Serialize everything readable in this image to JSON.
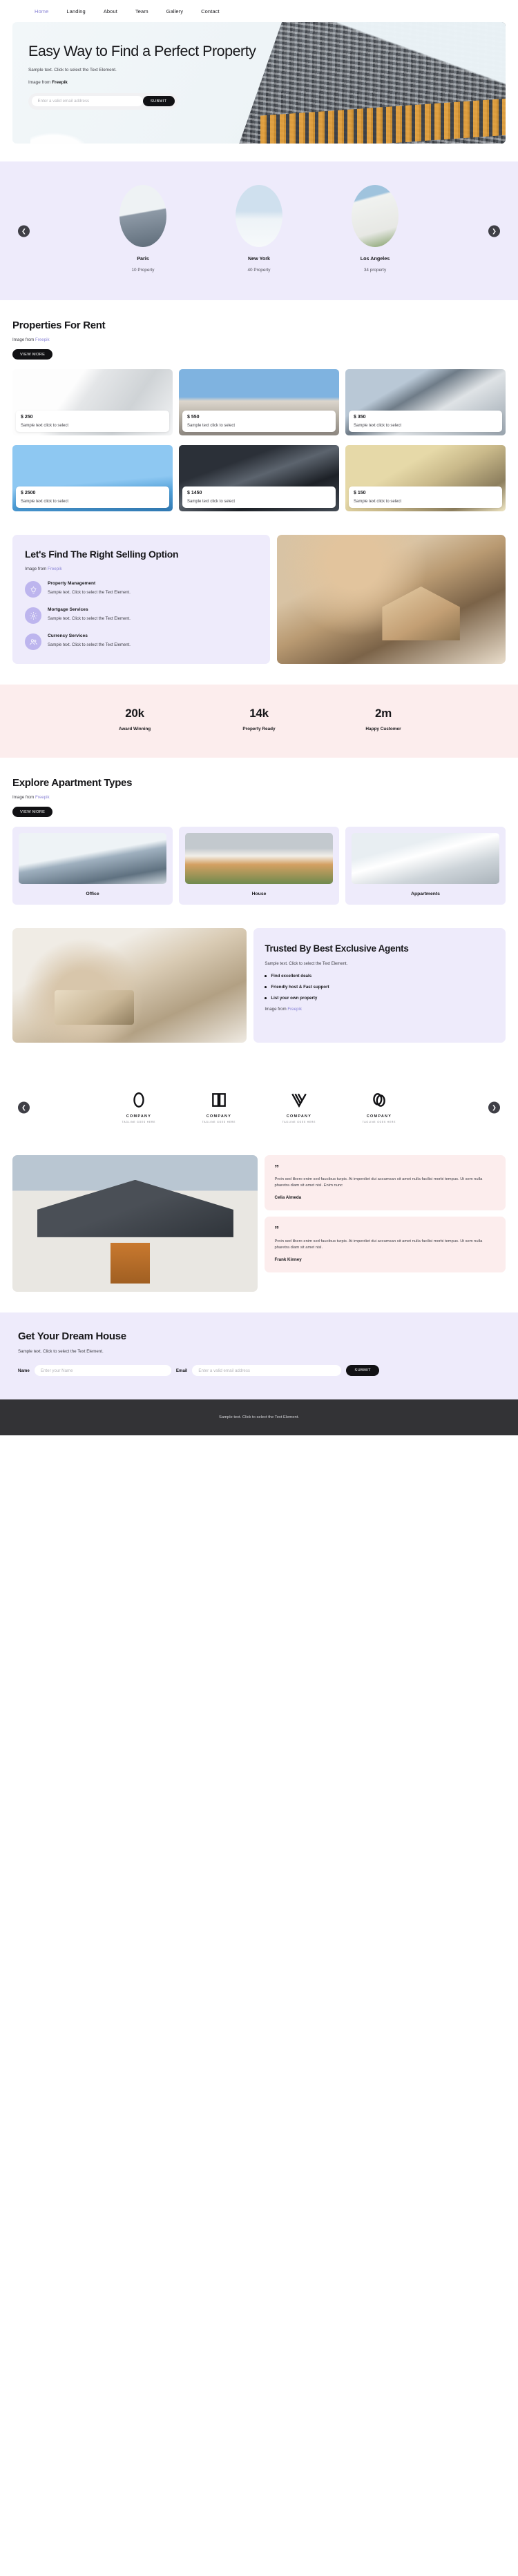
{
  "nav": {
    "items": [
      {
        "label": "Home",
        "active": true
      },
      {
        "label": "Landing",
        "active": false
      },
      {
        "label": "About",
        "active": false
      },
      {
        "label": "Team",
        "active": false
      },
      {
        "label": "Gallery",
        "active": false
      },
      {
        "label": "Contact",
        "active": false
      }
    ]
  },
  "hero": {
    "title": "Easy Way to Find a Perfect Property",
    "subtitle": "Sample text. Click to select the Text Element.",
    "credit_prefix": "Image from ",
    "credit_source": "Freepik",
    "email_placeholder": "Enter a valid email address",
    "email_value": "",
    "submit_label": "SUBMIT"
  },
  "cities": {
    "prev_icon": "chevron-left-icon",
    "next_icon": "chevron-right-icon",
    "items": [
      {
        "name": "Paris",
        "count": "10 Property"
      },
      {
        "name": "New York",
        "count": "40 Property"
      },
      {
        "name": "Los Angeles",
        "count": "34 property"
      }
    ]
  },
  "rent": {
    "title": "Properties For Rent",
    "credit_prefix": "Image from ",
    "credit_source": "Freepik",
    "view_more_label": "VIEW MORE",
    "cards": [
      {
        "price": "$ 250",
        "caption": "Sample text click to select"
      },
      {
        "price": "$ 550",
        "caption": "Sample text click to select"
      },
      {
        "price": "$ 350",
        "caption": "Sample text click to select"
      },
      {
        "price": "$ 2500",
        "caption": "Sample text click to select"
      },
      {
        "price": "$ 1450",
        "caption": "Sample text click to select"
      },
      {
        "price": "$ 150",
        "caption": "Sample text click to select"
      }
    ]
  },
  "selling": {
    "title": "Let's Find The Right Selling Option",
    "credit_prefix": "Image from ",
    "credit_source": "Freepik",
    "services": [
      {
        "icon": "lightbulb-icon",
        "title": "Property Management",
        "body": "Sample text. Click to select the Text Element."
      },
      {
        "icon": "gear-icon",
        "title": "Mortgage Services",
        "body": "Sample text. Click to select the Text Element."
      },
      {
        "icon": "users-icon",
        "title": "Currency Services",
        "body": "Sample text. Click to select the Text Element."
      }
    ]
  },
  "stats": [
    {
      "value": "20k",
      "label": "Award Winning"
    },
    {
      "value": "14k",
      "label": "Property Ready"
    },
    {
      "value": "2m",
      "label": "Happy Customer"
    }
  ],
  "types": {
    "title": "Explore Apartment Types",
    "credit_prefix": "Image from ",
    "credit_source": "Freepik",
    "view_more_label": "VIEW MORE",
    "items": [
      {
        "label": "Office"
      },
      {
        "label": "House"
      },
      {
        "label": "Appartments"
      }
    ]
  },
  "trusted": {
    "title": "Trusted By Best Exclusive Agents",
    "subtitle": "Sample text. Click to select the Text Element.",
    "bullets": [
      "Find excellent deals",
      "Friendly host & Fast support",
      "List your own property"
    ],
    "credit_prefix": "Image from ",
    "credit_source": "Freepik"
  },
  "logos": {
    "prev_icon": "chevron-left-icon",
    "next_icon": "chevron-right-icon",
    "items": [
      {
        "name": "COMPANY",
        "tagline": "TAGLINE GOES HERE",
        "mark": "oval-ring-logo"
      },
      {
        "name": "COMPANY",
        "tagline": "TAGLINE GOES HERE",
        "mark": "open-book-logo"
      },
      {
        "name": "COMPANY",
        "tagline": "TAGLINE GOES HERE",
        "mark": "v-stripes-logo"
      },
      {
        "name": "COMPANY",
        "tagline": "TAGLINE GOES HERE",
        "mark": "double-ring-logo"
      }
    ]
  },
  "testimonials": [
    {
      "quote_mark": "”",
      "text": "Proin sed libero enim sed faucibus turpis. At imperdiet dui accumsan sit amet nulla facilisi morbi tempus. Ut sem nulla pharetra diam sit amet nisl. Enim nunc",
      "name": "Celia Almeda"
    },
    {
      "quote_mark": "”",
      "text": "Proin sed libero enim sed faucibus turpis. At imperdiet dui accumsan sit amet nulla facilisi morbi tempus. Ut sem nulla pharetra diam sit amet nisl.",
      "name": "Frank Kinney"
    }
  ],
  "cta": {
    "title": "Get Your Dream House",
    "subtitle": "Sample text. Click to select the Text Element.",
    "name_label": "Name",
    "name_placeholder": "Enter your Name",
    "name_value": "",
    "email_label": "Email",
    "email_placeholder": "Enter a valid email address",
    "email_value": "",
    "submit_label": "SUBMIT"
  },
  "footer": {
    "text": "Sample text. Click to select the Text Element."
  },
  "colors": {
    "accent_purple": "#8b85d6",
    "lavender_bg": "#eeebfb",
    "pink_bg": "#fceded",
    "black": "#111114",
    "footer_bg": "#333336"
  }
}
